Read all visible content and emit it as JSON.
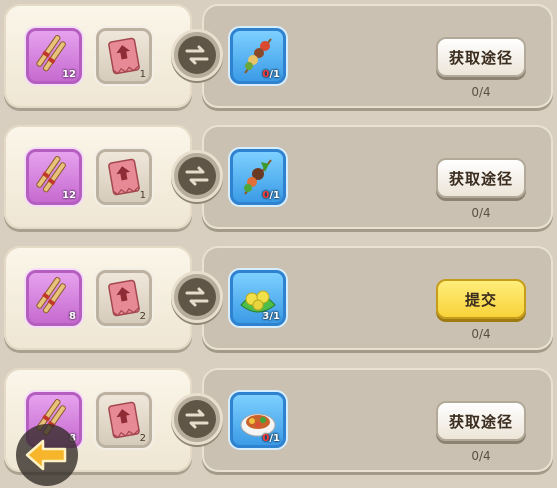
{
  "rows": [
    {
      "mat1": {
        "icon": "wooden-skewers-icon",
        "count": "12"
      },
      "mat2": {
        "icon": "raw-meat-card-icon",
        "count": "1"
      },
      "target": {
        "icon": "vegetable-meat-skewer-icon",
        "have": "0",
        "need": "/1"
      },
      "button": {
        "label": "获取途径",
        "style": "white"
      },
      "progress": "0/4"
    },
    {
      "mat1": {
        "icon": "wooden-skewers-icon",
        "count": "12"
      },
      "mat2": {
        "icon": "raw-meat-card-icon",
        "count": "1"
      },
      "target": {
        "icon": "green-pepper-skewer-icon",
        "have": "0",
        "need": "/1"
      },
      "button": {
        "label": "获取途径",
        "style": "white"
      },
      "progress": "0/4"
    },
    {
      "mat1": {
        "icon": "wooden-skewers-icon",
        "count": "8"
      },
      "mat2": {
        "icon": "raw-meat-card-icon",
        "count": "2"
      },
      "target": {
        "icon": "lemon-leaf-plate-icon",
        "have": "3",
        "need": "/1"
      },
      "button": {
        "label": "提交",
        "style": "yellow"
      },
      "progress": "0/4"
    },
    {
      "mat1": {
        "icon": "wooden-skewers-icon",
        "count": "8"
      },
      "mat2": {
        "icon": "raw-meat-card-icon",
        "count": "2"
      },
      "target": {
        "icon": "grilled-dish-plate-icon",
        "have": "0",
        "need": "/1"
      },
      "button": {
        "label": "获取途径",
        "style": "white"
      },
      "progress": "0/4"
    }
  ],
  "back_button": {
    "icon": "back-arrow-icon"
  },
  "colors": {
    "accent_yellow": "#f8d23a",
    "slot_purple": "#c66ad0",
    "slot_blue": "#3b9be6",
    "missing_red": "#ff3b3b"
  }
}
